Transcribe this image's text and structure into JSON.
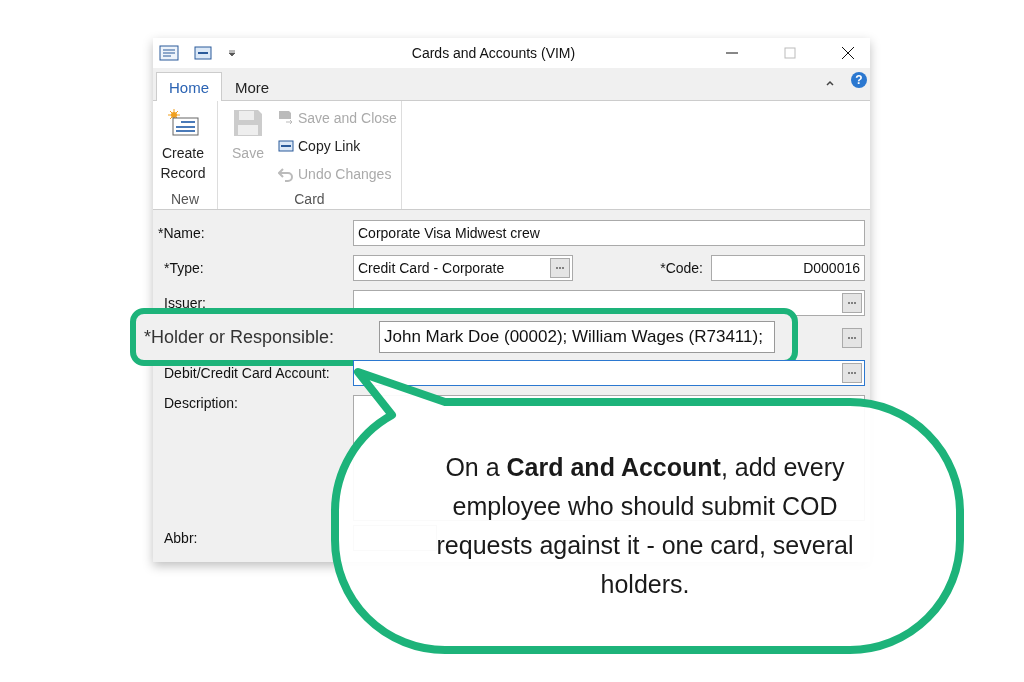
{
  "window": {
    "title": "Cards and Accounts (VIM)"
  },
  "tabs": [
    {
      "label": "Home",
      "selected": true
    },
    {
      "label": "More",
      "selected": false
    }
  ],
  "help_button": "?",
  "ribbon": {
    "groups": [
      {
        "label": "New",
        "buttons": [
          {
            "label": "Create Record",
            "kind": "large",
            "disabled": false
          }
        ]
      },
      {
        "label": "Card",
        "buttons": [
          {
            "label": "Save",
            "kind": "large",
            "disabled": true
          },
          {
            "label": "Save and Close",
            "kind": "small",
            "disabled": true
          },
          {
            "label": "Copy Link",
            "kind": "small",
            "disabled": false
          },
          {
            "label": "Undo Changes",
            "kind": "small",
            "disabled": true
          }
        ]
      }
    ]
  },
  "form": {
    "fields": [
      {
        "label": "*Name:",
        "value": "Corporate Visa Midwest crew",
        "kind": "text"
      },
      {
        "label": "*Type:",
        "value": "Credit Card - Corporate",
        "kind": "lookup",
        "side": {
          "label": "*Code:",
          "value": "D000016"
        }
      },
      {
        "label": "Issuer:",
        "kind": "lookup"
      },
      {
        "label": "*Holder or Responsible:",
        "value": "John Mark Doe (00002); William Wages (R73411);",
        "kind": "lookup",
        "highlighted": true
      },
      {
        "label": "Debit/Credit Card Account:",
        "kind": "lookup",
        "focused": true
      },
      {
        "label": "Description:",
        "kind": "textarea"
      },
      {
        "label": "Abbr:",
        "kind": "short"
      }
    ]
  },
  "callout": {
    "text": "On a **Card and Account**, add every employee who should submit COD requests against it - one card, several holders."
  }
}
